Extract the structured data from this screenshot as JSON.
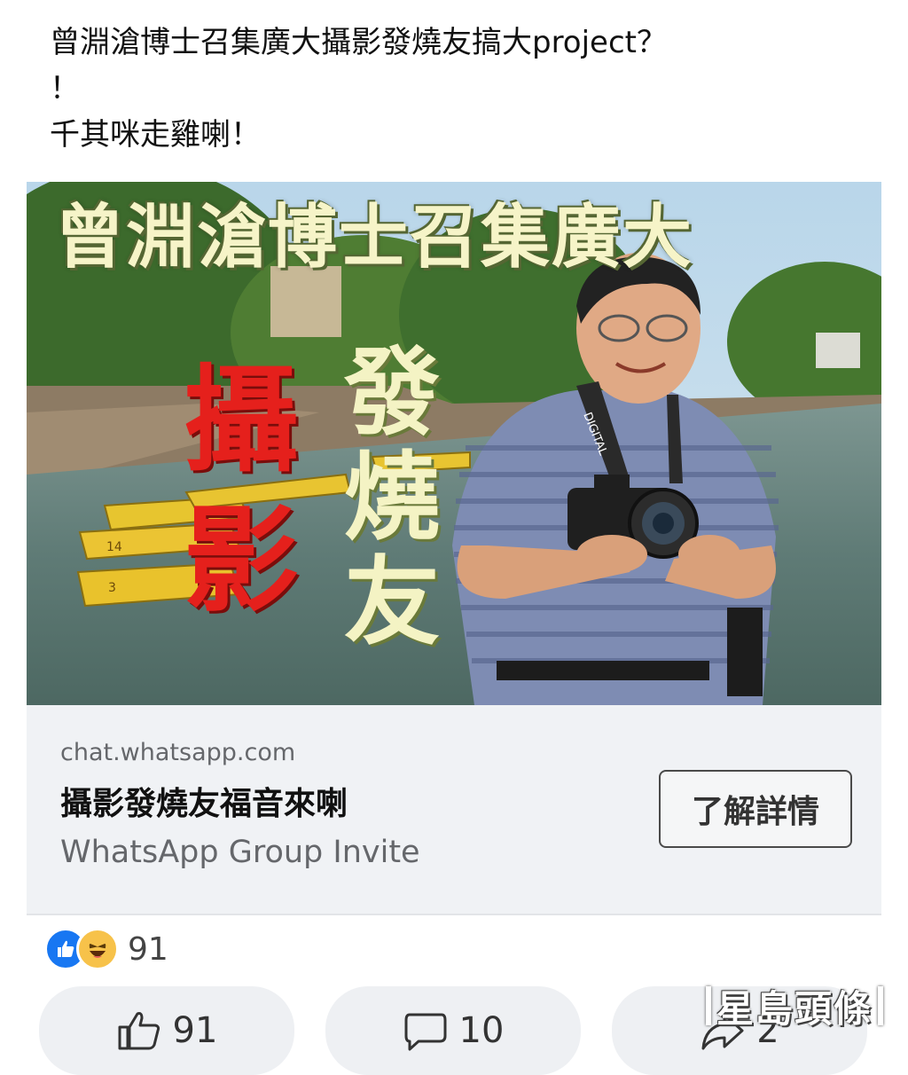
{
  "post": {
    "lines": [
      "曾淵滄博士召集廣大攝影發燒友搞大project？",
      "！",
      "千其咪走雞喇！"
    ]
  },
  "hero": {
    "title": "曾淵滄博士召集廣大",
    "red_vertical": "攝影",
    "cream_vertical": "發燒友",
    "strap_text": "DIGITAL",
    "boat_numbers": [
      "14",
      "3"
    ]
  },
  "link_card": {
    "domain": "chat.whatsapp.com",
    "title": "攝影發燒友福音來喇",
    "description": "WhatsApp Group Invite",
    "button_label": "了解詳情"
  },
  "reactions": {
    "count": "91"
  },
  "actions": {
    "like_count": "91",
    "comment_count": "10",
    "share_count": "2"
  },
  "watermark": {
    "text": "星島頭條"
  },
  "colors": {
    "facebook_blue": "#1877f2",
    "haha_yellow": "#f7c24a",
    "card_bg": "#f0f2f5",
    "red_text": "#e5201c"
  }
}
